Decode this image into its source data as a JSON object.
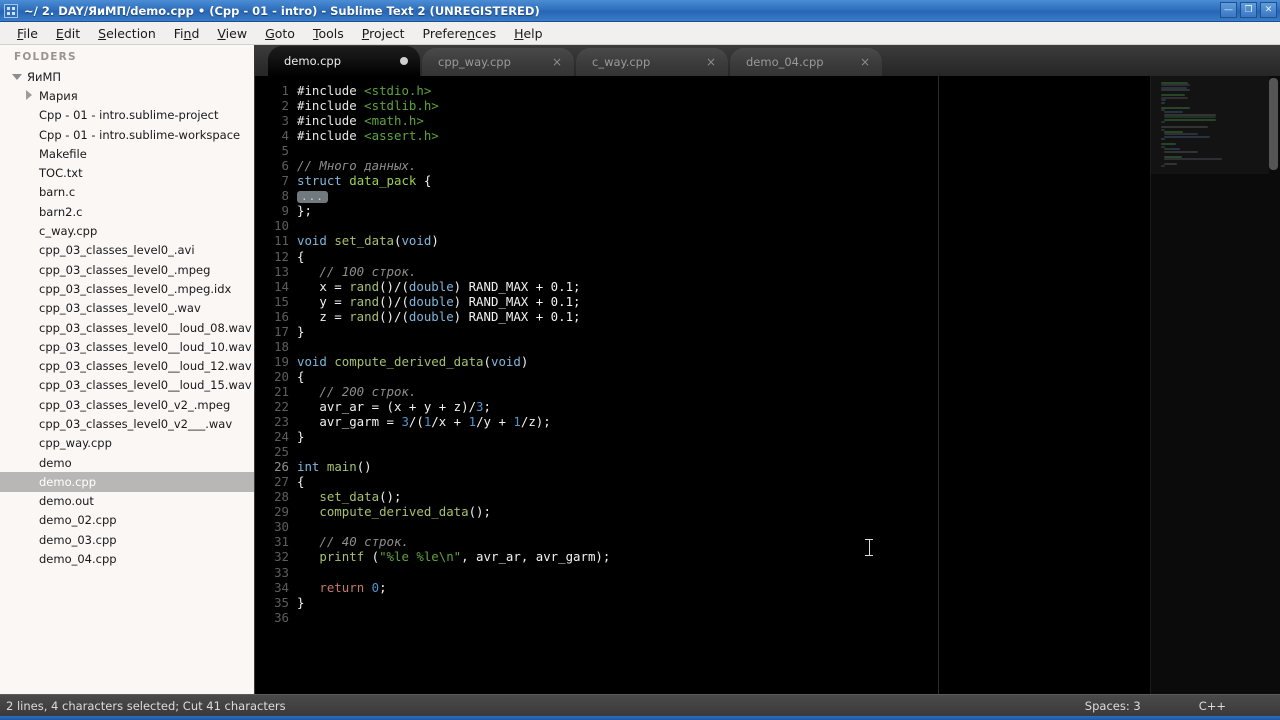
{
  "window": {
    "title": "~/ 2. DAY/ЯиМП/demo.cpp • (Cpp - 01 - intro) - Sublime Text 2 (UNREGISTERED)",
    "icon": "grid-icon",
    "minimize_label": "—",
    "maximize_label": "❐",
    "close_label": "✕",
    "titlebar_color": "#2f6fbd"
  },
  "menubar": {
    "items": [
      {
        "label": "File",
        "mnemonic": "F"
      },
      {
        "label": "Edit",
        "mnemonic": "E"
      },
      {
        "label": "Selection",
        "mnemonic": "S"
      },
      {
        "label": "Find",
        "mnemonic": "n"
      },
      {
        "label": "View",
        "mnemonic": "V"
      },
      {
        "label": "Goto",
        "mnemonic": "G"
      },
      {
        "label": "Tools",
        "mnemonic": "T"
      },
      {
        "label": "Project",
        "mnemonic": "P"
      },
      {
        "label": "Preferences",
        "mnemonic": "n"
      },
      {
        "label": "Help",
        "mnemonic": "H"
      }
    ]
  },
  "sidebar": {
    "header": "FOLDERS",
    "root": {
      "label": "ЯиМП",
      "expanded": true
    },
    "items": [
      {
        "label": "Мария",
        "type": "folder",
        "expanded": false,
        "selected": false
      },
      {
        "label": "Cpp - 01 - intro.sublime-project",
        "type": "file",
        "selected": false
      },
      {
        "label": "Cpp - 01 - intro.sublime-workspace",
        "type": "file",
        "selected": false
      },
      {
        "label": "Makefile",
        "type": "file",
        "selected": false
      },
      {
        "label": "TOC.txt",
        "type": "file",
        "selected": false
      },
      {
        "label": "barn.c",
        "type": "file",
        "selected": false
      },
      {
        "label": "barn2.c",
        "type": "file",
        "selected": false
      },
      {
        "label": "c_way.cpp",
        "type": "file",
        "selected": false
      },
      {
        "label": "cpp_03_classes_level0_.avi",
        "type": "file",
        "selected": false
      },
      {
        "label": "cpp_03_classes_level0_.mpeg",
        "type": "file",
        "selected": false
      },
      {
        "label": "cpp_03_classes_level0_.mpeg.idx",
        "type": "file",
        "selected": false
      },
      {
        "label": "cpp_03_classes_level0_.wav",
        "type": "file",
        "selected": false
      },
      {
        "label": "cpp_03_classes_level0__loud_08.wav",
        "type": "file",
        "selected": false
      },
      {
        "label": "cpp_03_classes_level0__loud_10.wav",
        "type": "file",
        "selected": false
      },
      {
        "label": "cpp_03_classes_level0__loud_12.wav",
        "type": "file",
        "selected": false
      },
      {
        "label": "cpp_03_classes_level0__loud_15.wav",
        "type": "file",
        "selected": false
      },
      {
        "label": "cpp_03_classes_level0_v2_.mpeg",
        "type": "file",
        "selected": false
      },
      {
        "label": "cpp_03_classes_level0_v2___.wav",
        "type": "file",
        "selected": false
      },
      {
        "label": "cpp_way.cpp",
        "type": "file",
        "selected": false
      },
      {
        "label": "demo",
        "type": "file",
        "selected": false
      },
      {
        "label": "demo.cpp",
        "type": "file",
        "selected": true
      },
      {
        "label": "demo.out",
        "type": "file",
        "selected": false
      },
      {
        "label": "demo_02.cpp",
        "type": "file",
        "selected": false
      },
      {
        "label": "demo_03.cpp",
        "type": "file",
        "selected": false
      },
      {
        "label": "demo_04.cpp",
        "type": "file",
        "selected": false
      }
    ]
  },
  "tabs": [
    {
      "label": "demo.cpp",
      "active": true,
      "modified": true,
      "close_label": ""
    },
    {
      "label": "cpp_way.cpp",
      "active": false,
      "modified": false,
      "close_label": "×"
    },
    {
      "label": "c_way.cpp",
      "active": false,
      "modified": false,
      "close_label": "×"
    },
    {
      "label": "demo_04.cpp",
      "active": false,
      "modified": false,
      "close_label": "×"
    }
  ],
  "editor": {
    "language": "C++",
    "fold_marker": "...",
    "lines": [
      {
        "n": "1",
        "text": "#include <stdio.h>"
      },
      {
        "n": "2",
        "text": "#include <stdlib.h>"
      },
      {
        "n": "3",
        "text": "#include <math.h>"
      },
      {
        "n": "4",
        "text": "#include <assert.h>"
      },
      {
        "n": "5",
        "text": ""
      },
      {
        "n": "6",
        "text": "// Много данных."
      },
      {
        "n": "7",
        "text": "struct data_pack {"
      },
      {
        "n": "8",
        "text": "..."
      },
      {
        "n": "9",
        "text": "};"
      },
      {
        "n": "10",
        "text": ""
      },
      {
        "n": "11",
        "text": "void set_data(void)"
      },
      {
        "n": "12",
        "text": "{"
      },
      {
        "n": "13",
        "text": "   // 100 строк."
      },
      {
        "n": "14",
        "text": "   x = rand()/(double) RAND_MAX + 0.1;"
      },
      {
        "n": "15",
        "text": "   y = rand()/(double) RAND_MAX + 0.1;"
      },
      {
        "n": "16",
        "text": "   z = rand()/(double) RAND_MAX + 0.1;"
      },
      {
        "n": "17",
        "text": "}"
      },
      {
        "n": "18",
        "text": ""
      },
      {
        "n": "19",
        "text": "void compute_derived_data(void)"
      },
      {
        "n": "20",
        "text": "{"
      },
      {
        "n": "21",
        "text": "   // 200 строк."
      },
      {
        "n": "22",
        "text": "   avr_ar = (x + y + z)/3;"
      },
      {
        "n": "23",
        "text": "   avr_garm = 3/(1/x + 1/y + 1/z);"
      },
      {
        "n": "24",
        "text": "}"
      },
      {
        "n": "25",
        "text": ""
      },
      {
        "n": "26",
        "text": "int main()"
      },
      {
        "n": "27",
        "text": "{"
      },
      {
        "n": "28",
        "text": "   set_data();"
      },
      {
        "n": "29",
        "text": "   compute_derived_data();"
      },
      {
        "n": "30",
        "text": ""
      },
      {
        "n": "31",
        "text": "   // 40 строк."
      },
      {
        "n": "32",
        "text": "   printf (\"%le %le\\n\", avr_ar, avr_garm);"
      },
      {
        "n": "33",
        "text": ""
      },
      {
        "n": "34",
        "text": "   return 0;"
      },
      {
        "n": "35",
        "text": "}"
      },
      {
        "n": "36",
        "text": ""
      }
    ]
  },
  "statusbar": {
    "left": "2 lines, 4 characters selected; Cut 41 characters",
    "indent": "Spaces: 3",
    "syntax": "C++"
  }
}
